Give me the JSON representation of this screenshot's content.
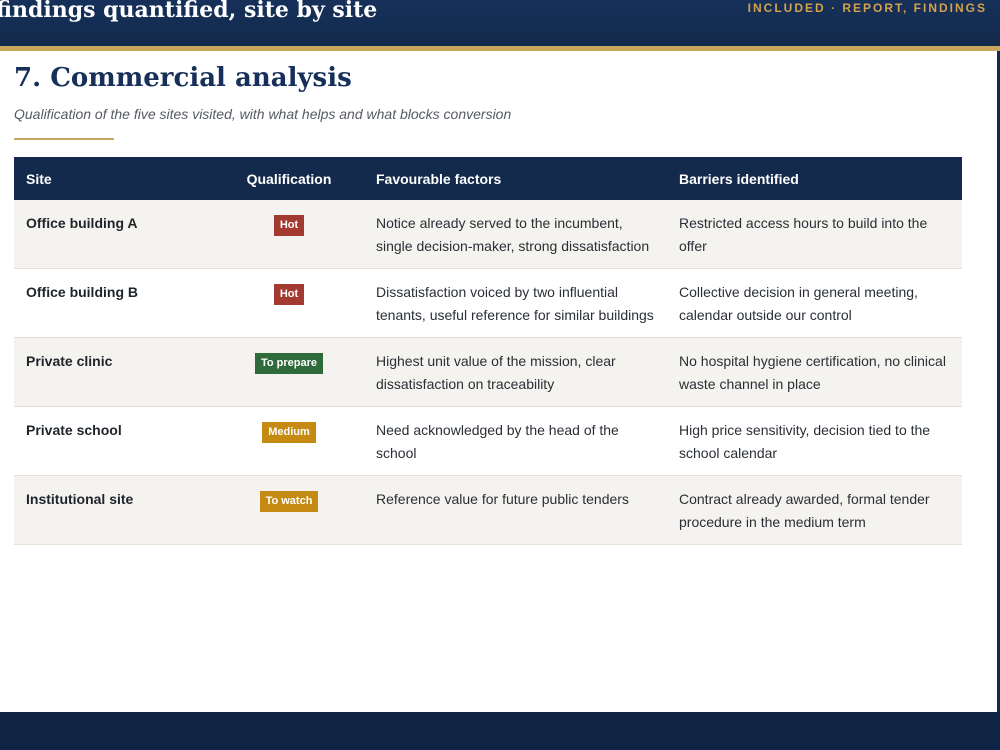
{
  "header": {
    "title": "findings quantified, site by site",
    "tag": "INCLUDED · REPORT, FINDINGS"
  },
  "section": {
    "title": "7. Commercial analysis",
    "subtitle": "Qualification of the five sites visited, with what helps and what blocks conversion"
  },
  "colors": {
    "navy": "#132a4c",
    "gold": "#c9a55c",
    "hot": "#a33a32",
    "to_prepare": "#2f6b3a",
    "medium": "#c48a12",
    "to_watch": "#c48a12"
  },
  "table": {
    "columns": [
      "Site",
      "Qualification",
      "Favourable factors",
      "Barriers identified"
    ],
    "rows": [
      {
        "site": "Office building A",
        "qualification": "Hot",
        "qual_color": "#a33a32",
        "favourable": "Notice already served to the incumbent, single decision-maker, strong dissatisfaction",
        "barriers": "Restricted access hours to build into the offer"
      },
      {
        "site": "Office building B",
        "qualification": "Hot",
        "qual_color": "#a33a32",
        "favourable": "Dissatisfaction voiced by two influential tenants, useful reference for similar buildings",
        "barriers": "Collective decision in general meeting, calendar outside our control"
      },
      {
        "site": "Private clinic",
        "qualification": "To prepare",
        "qual_color": "#2f6b3a",
        "favourable": "Highest unit value of the mission, clear dissatisfaction on traceability",
        "barriers": "No hospital hygiene certification, no clinical waste channel in place"
      },
      {
        "site": "Private school",
        "qualification": "Medium",
        "qual_color": "#c48a12",
        "favourable": "Need acknowledged by the head of the school",
        "barriers": "High price sensitivity, decision tied to the school calendar"
      },
      {
        "site": "Institutional site",
        "qualification": "To watch",
        "qual_color": "#c48a12",
        "favourable": "Reference value for future public tenders",
        "barriers": "Contract already awarded, formal tender procedure in the medium term"
      }
    ]
  }
}
